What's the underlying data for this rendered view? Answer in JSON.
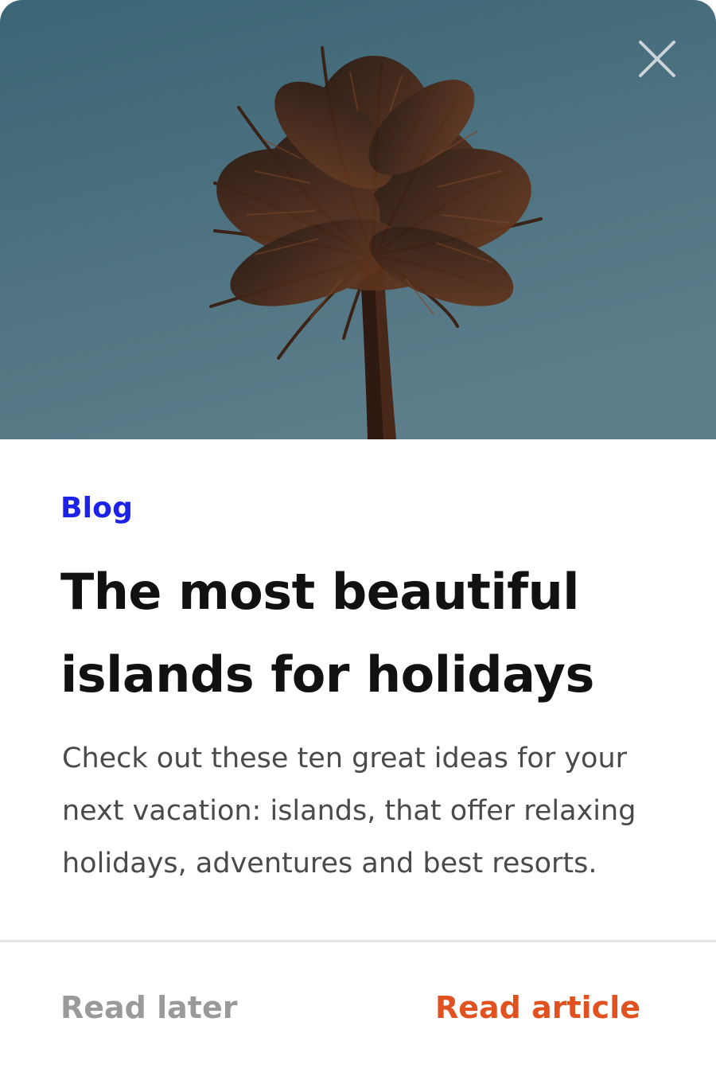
{
  "card": {
    "image": {
      "subject": "palm-tree-against-sky"
    },
    "category": "Blog",
    "title": "The most beautiful islands for holidays",
    "description": "Check out these ten great ideas for your next vacation: islands, that offer relaxing holidays, adventures and best resorts.",
    "actions": {
      "read_later": "Read later",
      "read_article": "Read article"
    }
  },
  "icons": {
    "close": "close-icon"
  },
  "colors": {
    "category": "#1c22e6",
    "title": "#111111",
    "description": "#4a4a4a",
    "read_later": "#9a9a9a",
    "read_article": "#e0521f",
    "sky_top": "#3d6876",
    "sky_bottom": "#5a7b88"
  }
}
